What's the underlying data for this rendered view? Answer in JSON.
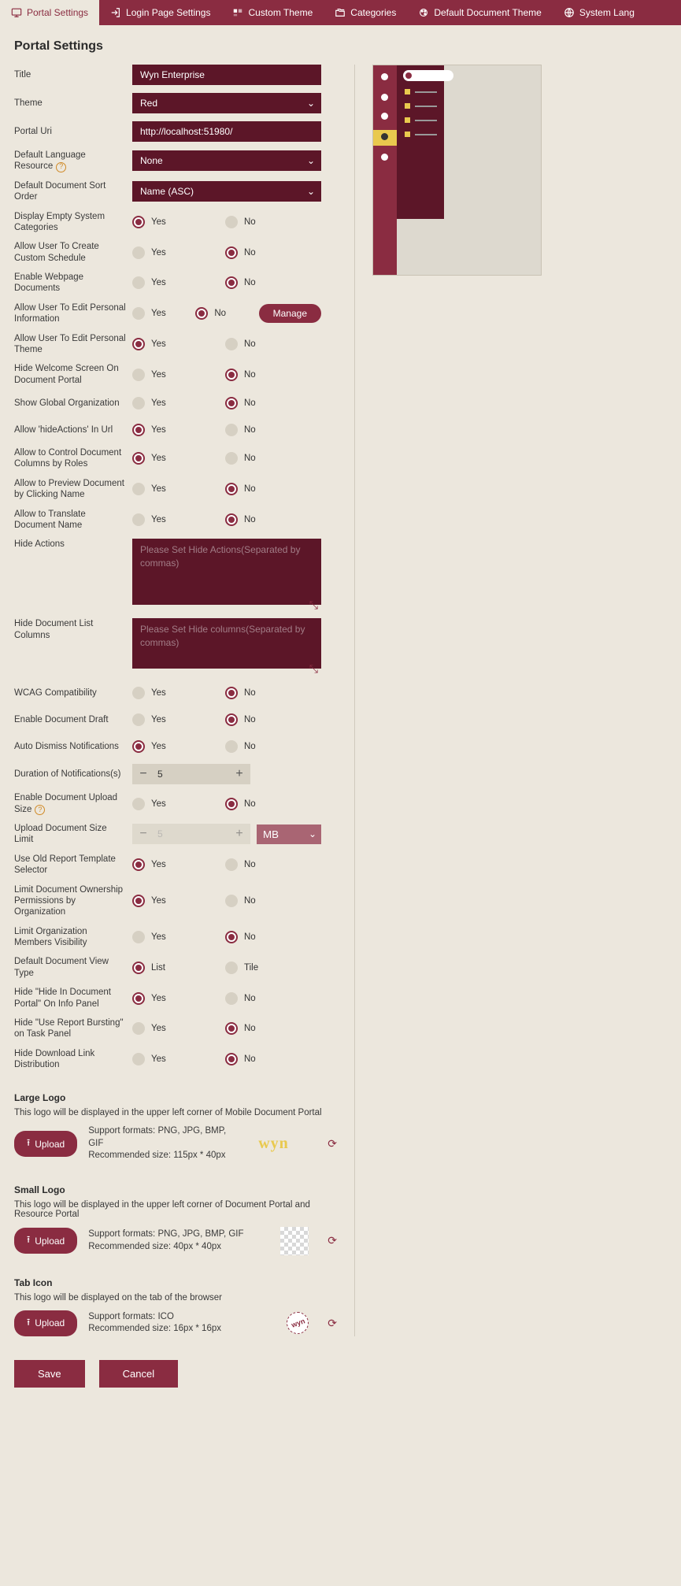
{
  "tabs": [
    {
      "label": "Portal Settings",
      "active": true,
      "icon": "monitor"
    },
    {
      "label": "Login Page Settings",
      "icon": "login"
    },
    {
      "label": "Custom Theme",
      "icon": "palette"
    },
    {
      "label": "Categories",
      "icon": "folders"
    },
    {
      "label": "Default Document Theme",
      "icon": "doc-theme"
    },
    {
      "label": "System Lang",
      "icon": "globe"
    }
  ],
  "page_title": "Portal Settings",
  "labels": {
    "title": "Title",
    "theme": "Theme",
    "portal_uri": "Portal Uri",
    "dlr": "Default Language Resource",
    "ddso": "Default Document Sort Order",
    "desc": "Display Empty System Categories",
    "aucs": "Allow User To Create Custom Schedule",
    "ewd": "Enable Webpage Documents",
    "auepi": "Allow User To Edit Personal Information",
    "auept": "Allow User To Edit Personal Theme",
    "hws": "Hide Welcome Screen On Document Portal",
    "sgo": "Show Global Organization",
    "aha": "Allow 'hideActions' In Url",
    "acdc": "Allow to Control Document Columns by Roles",
    "apdc": "Allow to Preview Document by Clicking Name",
    "atdn": "Allow to Translate Document Name",
    "ha": "Hide Actions",
    "hdlc": "Hide Document List Columns",
    "wcag": "WCAG Compatibility",
    "edd": "Enable Document Draft",
    "adn": "Auto Dismiss Notifications",
    "don": "Duration of Notifications(s)",
    "edus": "Enable Document Upload Size",
    "udsl": "Upload Document Size Limit",
    "uorts": "Use Old Report Template Selector",
    "ldop": "Limit Document Ownership Permissions by Organization",
    "lomv": "Limit Organization Members Visibility",
    "ddvt": "Default Document View Type",
    "hhip": "Hide \"Hide In Document Portal\" On Info Panel",
    "hurb": "Hide \"Use Report Bursting\" on Task Panel",
    "hdld": "Hide Download Link Distribution"
  },
  "values": {
    "title": "Wyn Enterprise",
    "theme": "Red",
    "portal_uri": "http://localhost:51980/",
    "dlr": "None",
    "ddso": "Name (ASC)",
    "don": "5",
    "upload_limit": "5",
    "unit": "MB"
  },
  "placeholders": {
    "ha": "Please Set Hide Actions(Separated by commas)",
    "hdlc": "Please Set Hide columns(Separated by commas)"
  },
  "opts": {
    "yes": "Yes",
    "no": "No",
    "list": "List",
    "tile": "Tile"
  },
  "manage": "Manage",
  "logos": {
    "large": {
      "title": "Large Logo",
      "desc": "This logo will be displayed in the upper left corner of Mobile Document Portal",
      "formats": "Support formats: PNG, JPG, BMP, GIF",
      "size": "Recommended size: 115px * 40px"
    },
    "small": {
      "title": "Small Logo",
      "desc": "This logo will be displayed in the upper left corner of Document Portal and Resource Portal",
      "formats": "Support formats: PNG, JPG, BMP, GIF",
      "size": "Recommended size: 40px * 40px"
    },
    "tab": {
      "title": "Tab Icon",
      "desc": "This logo will be displayed on the tab of the browser",
      "formats": "Support formats: ICO",
      "size": "Recommended size: 16px * 16px"
    }
  },
  "upload": "Upload",
  "save": "Save",
  "cancel": "Cancel",
  "radios": {
    "desc": "yes",
    "aucs": "no",
    "ewd": "no",
    "auepi": "no",
    "auept": "yes",
    "hws": "no",
    "sgo": "no",
    "aha": "yes",
    "acdc": "yes",
    "apdc": "no",
    "atdn": "no",
    "wcag": "no",
    "edd": "no",
    "adn": "yes",
    "edus": "no",
    "uorts": "yes",
    "ldop": "yes",
    "lomv": "no",
    "ddvt": "list",
    "hhip": "yes",
    "hurb": "no",
    "hdld": "no"
  }
}
